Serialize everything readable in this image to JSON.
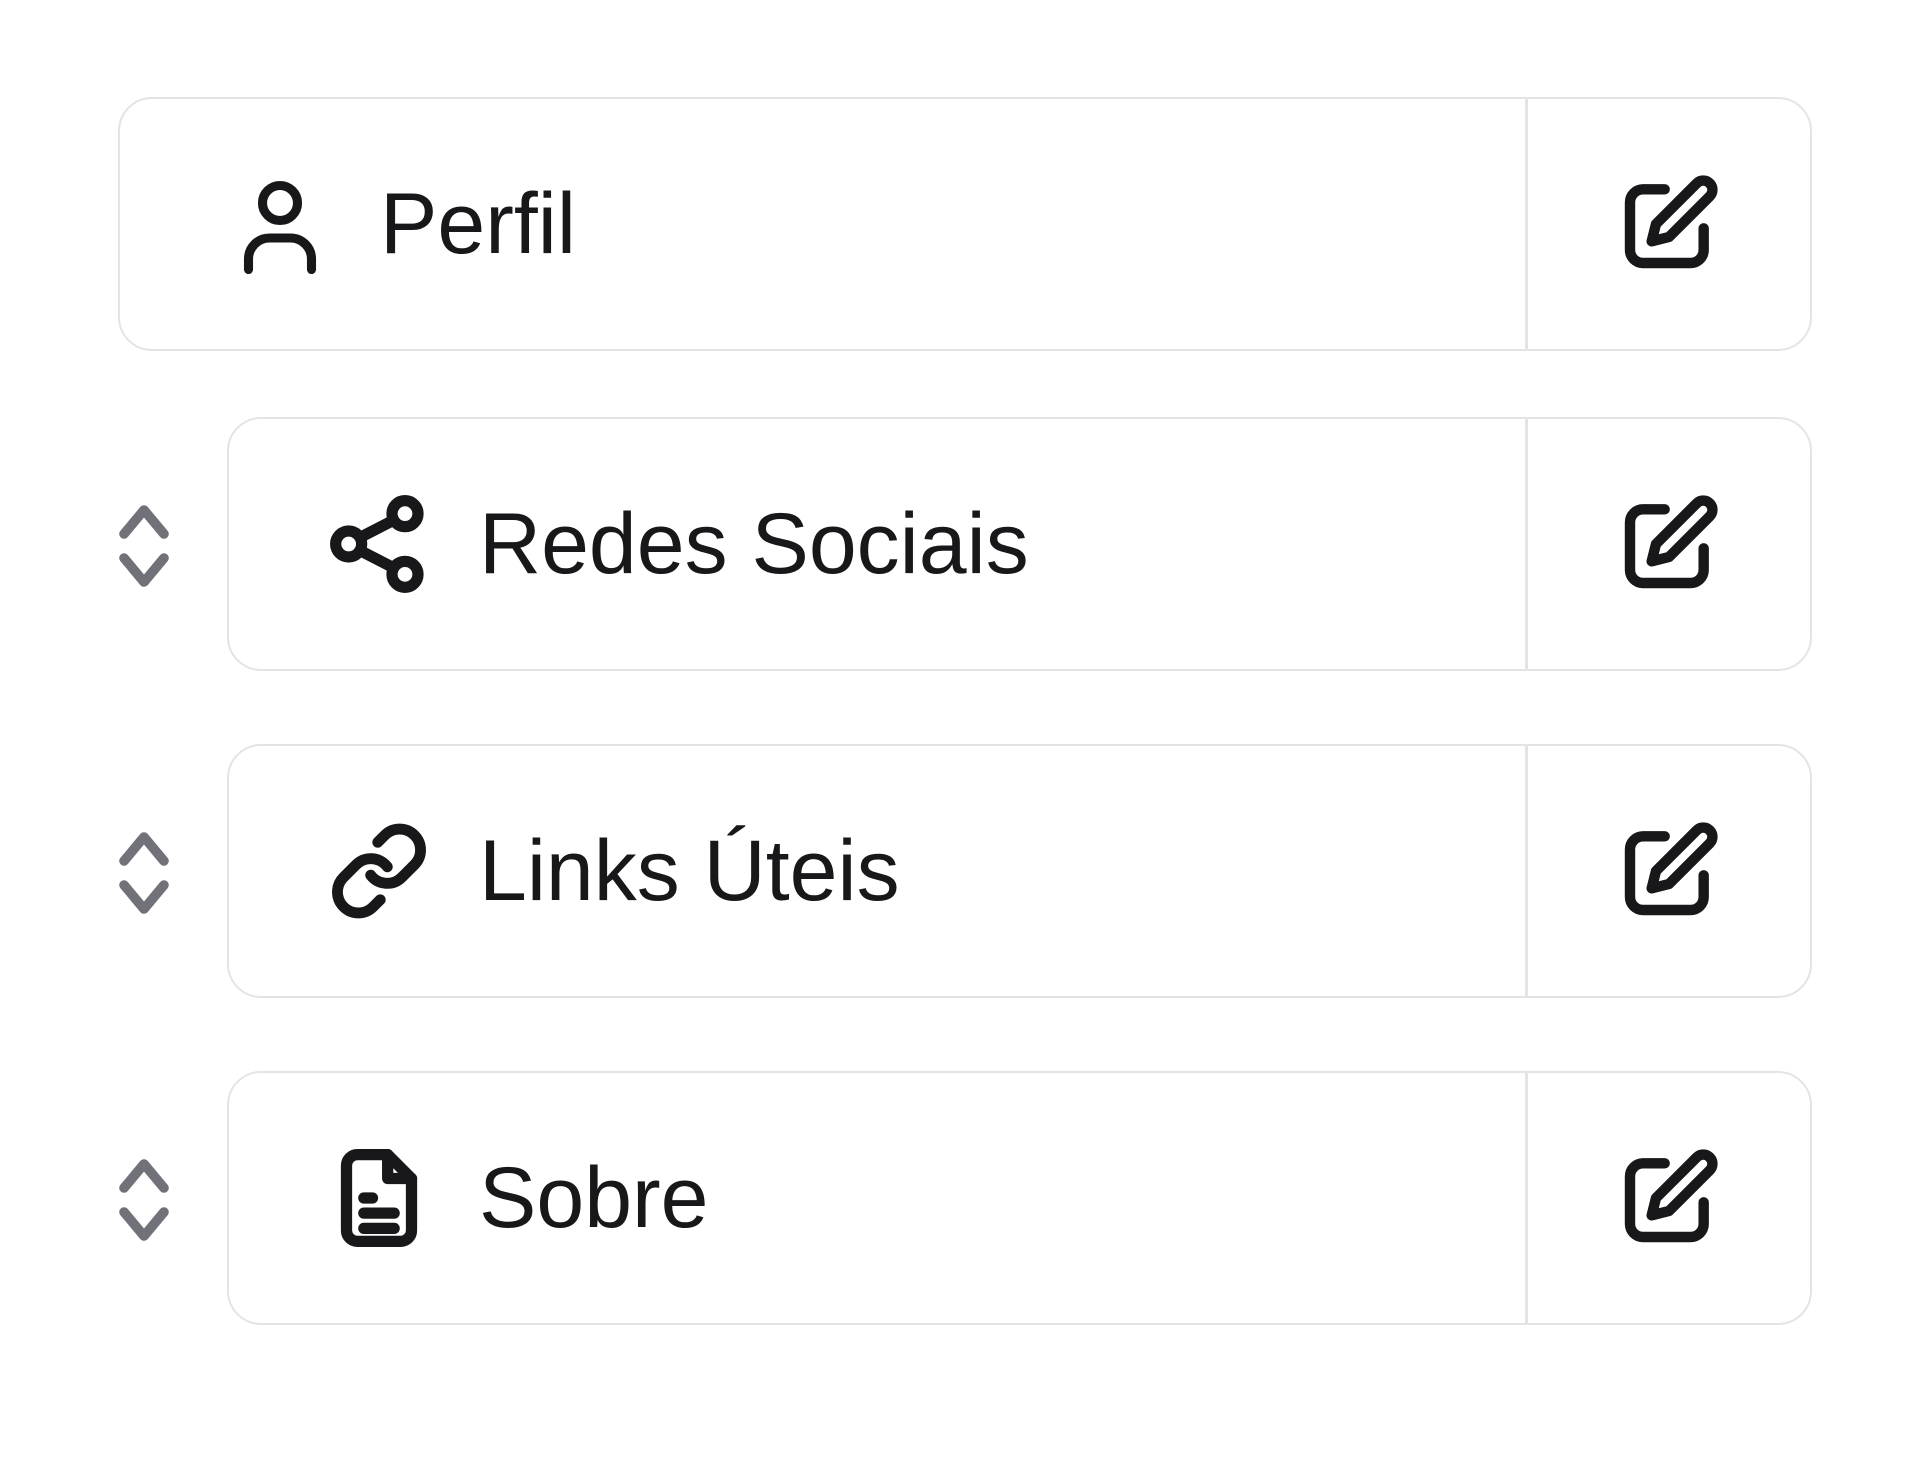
{
  "colors": {
    "text": "#18181b",
    "icon": "#18181b",
    "border": "#e4e4e7",
    "handle": "#71717a",
    "background": "#ffffff"
  },
  "sections": [
    {
      "id": "perfil",
      "label": "Perfil",
      "icon": "user-icon",
      "draggable": false,
      "edit_icon": "edit-icon"
    },
    {
      "id": "redes-sociais",
      "label": "Redes Sociais",
      "icon": "share-icon",
      "draggable": true,
      "edit_icon": "edit-icon"
    },
    {
      "id": "links-uteis",
      "label": "Links Úteis",
      "icon": "link-icon",
      "draggable": true,
      "edit_icon": "edit-icon"
    },
    {
      "id": "sobre",
      "label": "Sobre",
      "icon": "file-text-icon",
      "draggable": true,
      "edit_icon": "edit-icon"
    }
  ]
}
